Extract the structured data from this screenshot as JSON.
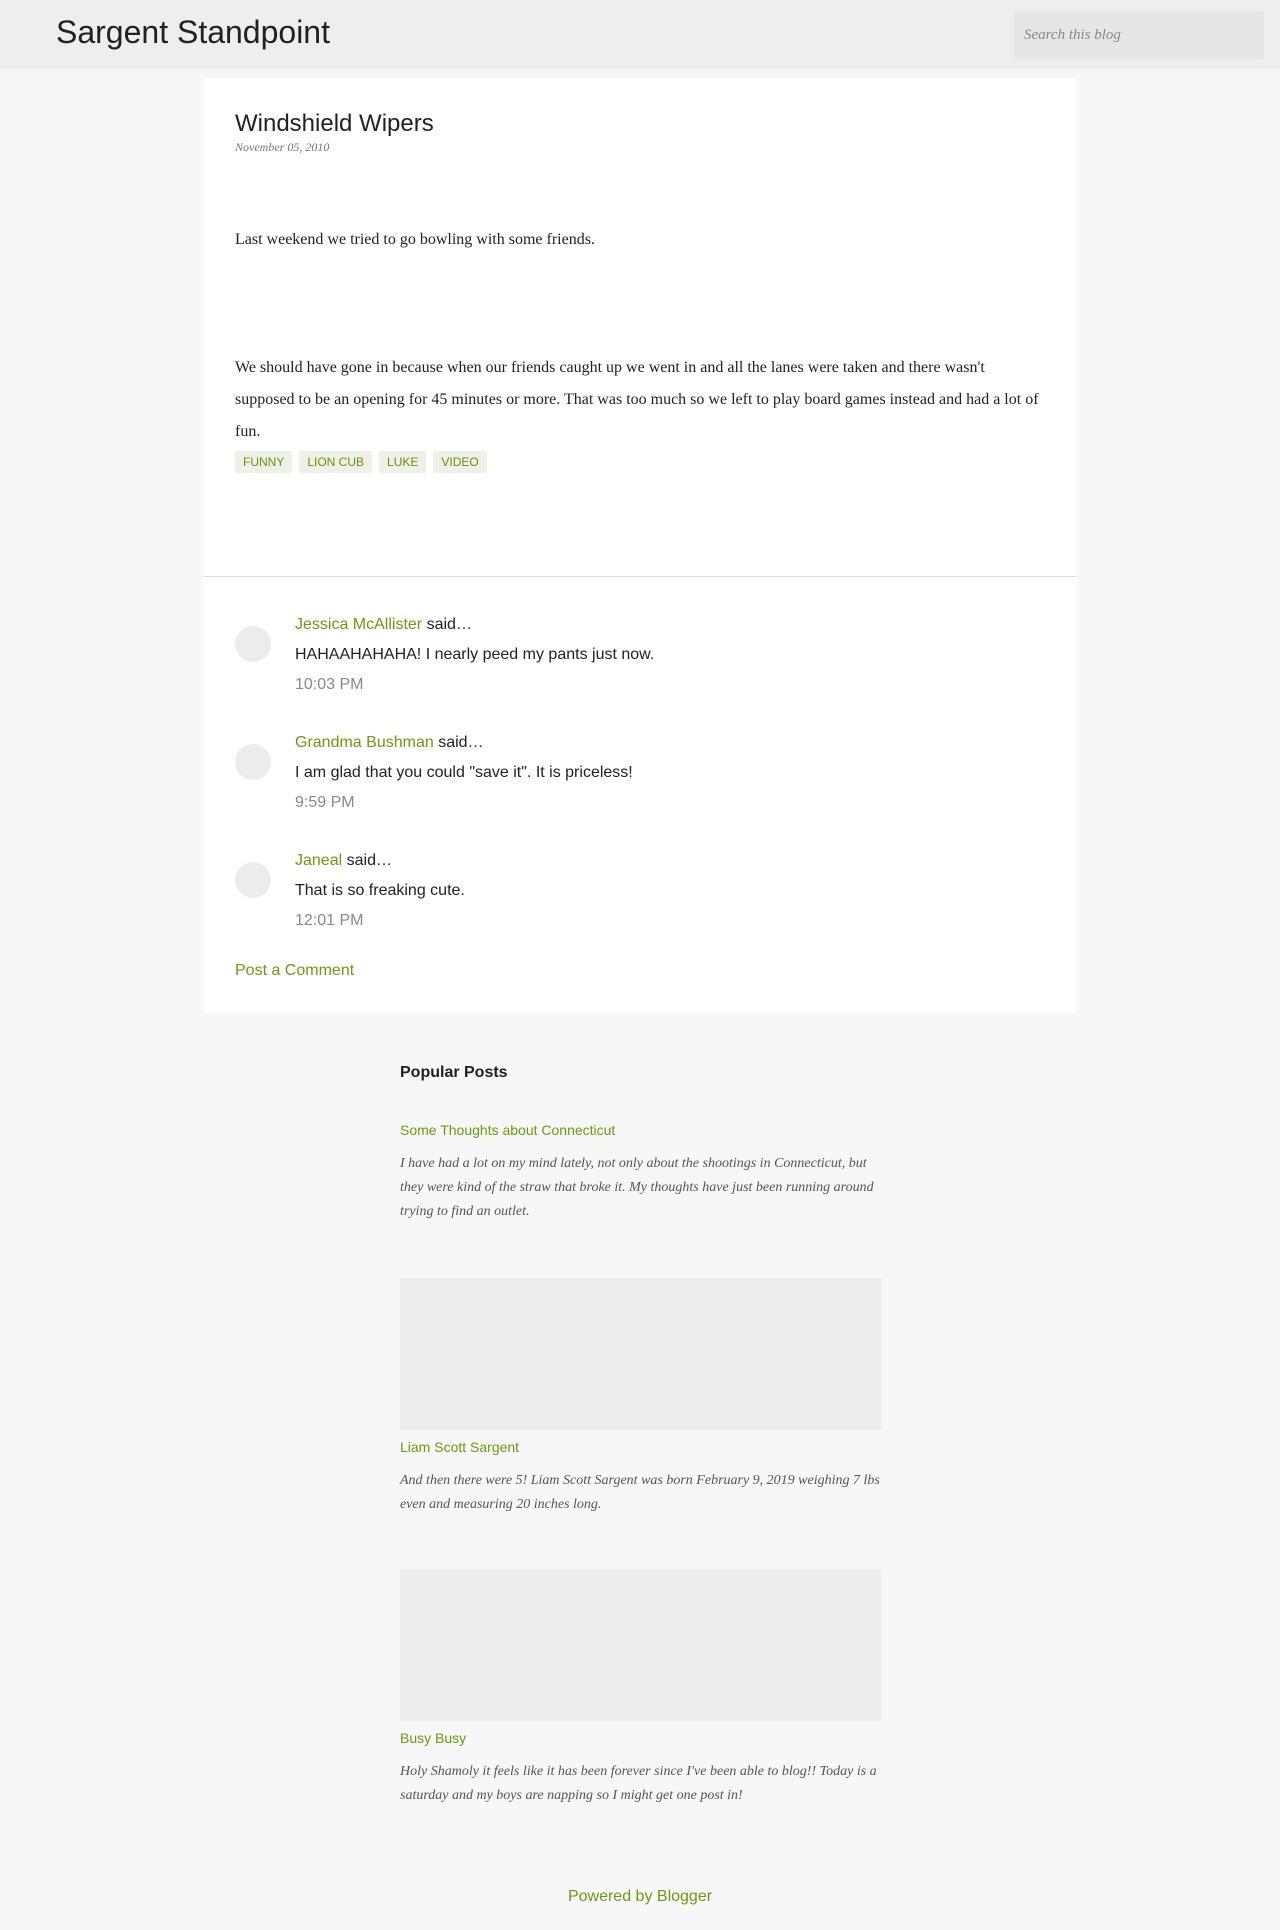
{
  "header": {
    "blog_title": "Sargent Standpoint",
    "search_placeholder": "Search this blog"
  },
  "post": {
    "title": "Windshield Wipers",
    "date": "November 05, 2010",
    "paragraphs": [
      "Last weekend we tried to go bowling with some friends.",
      "We should have gone in because when our friends caught up we went in and all the lanes were taken and there wasn't supposed to be an opening for 45 minutes or more. That was too much so we left to play board games instead and had a lot of fun."
    ],
    "labels": [
      "FUNNY",
      "LION CUB",
      "LUKE",
      "VIDEO"
    ]
  },
  "comments": [
    {
      "author": "Jessica McAllister",
      "said": "said…",
      "body": "HAHAAHAHAHA! I nearly peed my pants just now.",
      "time": "10:03 PM"
    },
    {
      "author": "Grandma Bushman",
      "said": "said…",
      "body": "I am glad that you could \"save it\". It is priceless!",
      "time": "9:59 PM"
    },
    {
      "author": "Janeal",
      "said": "said…",
      "body": "That is so freaking cute.",
      "time": "12:01 PM"
    }
  ],
  "post_comment_label": "Post a Comment",
  "popular_posts": {
    "heading": "Popular Posts",
    "items": [
      {
        "title": "Some Thoughts about Connecticut",
        "snippet": "I have had a lot on my mind lately, not only about the shootings in Connecticut, but they were kind of the straw that broke it. My thoughts have just been running around trying to find an outlet."
      },
      {
        "title": "Liam Scott Sargent",
        "snippet": "And then there were 5! Liam Scott Sargent was born February 9, 2019 weighing 7 lbs even and measuring 20 inches long."
      },
      {
        "title": "Busy Busy",
        "snippet": "Holy Shamoly it feels like it has been forever since I've been able to blog!! Today is a saturday and my boys are napping so I might get one post in!"
      }
    ]
  },
  "footer": {
    "powered_by": "Powered by Blogger"
  },
  "colors": {
    "accent": "#6a9a0f",
    "header_bg": "#eeeeee",
    "page_bg": "#f7f7f7",
    "label_bg": "#eef1e6"
  }
}
